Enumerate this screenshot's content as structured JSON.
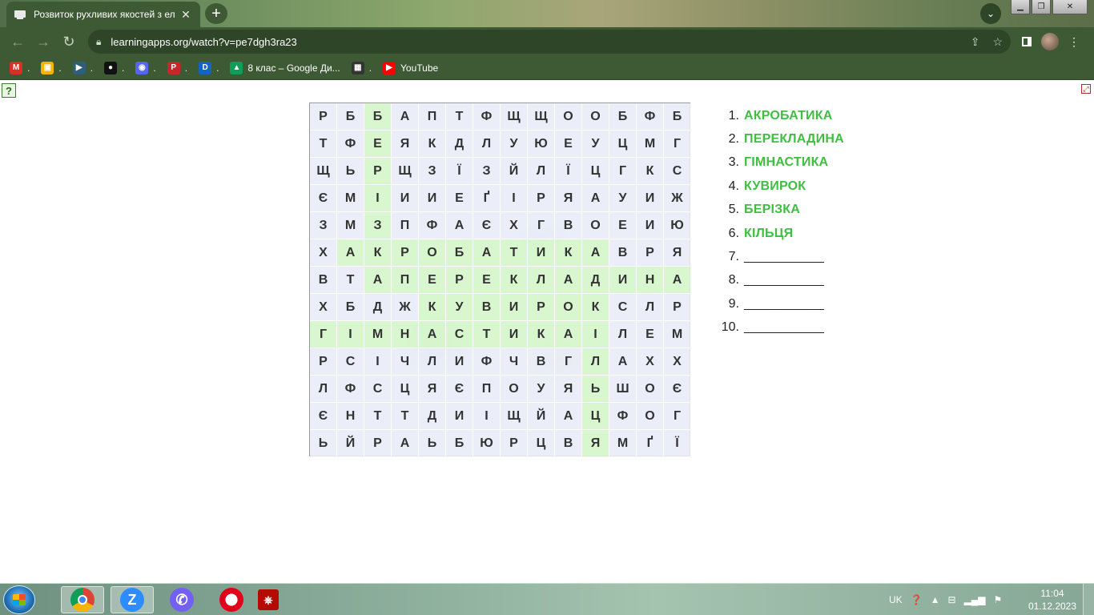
{
  "browser": {
    "tab_title": "Розвиток рухливих якостей з ел",
    "tab_close": "✕",
    "new_tab": "+",
    "url": "learningapps.org/watch?v=pe7dgh3ra23",
    "bookmarks": [
      {
        "name": "gmail",
        "label": ".",
        "color": "#d93025",
        "glyph": "M"
      },
      {
        "name": "drive-slides",
        "label": ".",
        "color": "#f4b400",
        "glyph": "▣"
      },
      {
        "name": "play",
        "label": ".",
        "color": "#2d5f7a",
        "glyph": "▶"
      },
      {
        "name": "ghost",
        "label": ".",
        "color": "#111111",
        "glyph": "●"
      },
      {
        "name": "discord",
        "label": ".",
        "color": "#5865f2",
        "glyph": "◉"
      },
      {
        "name": "p-app",
        "label": ".",
        "color": "#c62828",
        "glyph": "P"
      },
      {
        "name": "d-app",
        "label": ".",
        "color": "#1565c0",
        "glyph": "D"
      },
      {
        "name": "google-drive",
        "label": "8 клас – Google Ди...",
        "color": "#0f9d58",
        "glyph": "▲"
      },
      {
        "name": "pattern",
        "label": ".",
        "color": "#333333",
        "glyph": "▦"
      },
      {
        "name": "youtube",
        "label": "YouTube",
        "color": "#ff0000",
        "glyph": "▶"
      }
    ]
  },
  "page": {
    "help_glyph": "?",
    "fullscreen_glyph": "⤢"
  },
  "puzzle": {
    "rows": [
      "РББАПТФЩЩООБФБ",
      "ТФЕЯКДЛУЮЕУЦМГ",
      "ЩЬРЩЗЇЗЙЛЇЦГКС",
      "ЄМІИИЕҐІРЯАУИЖ",
      "ЗМЗПФАЄХГВОЕИЮ",
      "ХАКРОБАТИКАВРЯ",
      "ВТАПЕРЕКЛАДИНА",
      "ХБДЖКУВИРОКСЛР",
      "ГІМНАСТИКАІЛЕМ",
      "РСІЧЛИФЧВГЛАХХ",
      "ЛФСЦЯЄПОУЯЬШОЄ",
      "ЄНТТДИІЩЙАЦФОГ",
      "ЬЙРАЬБЮРЦВЯМҐЇ"
    ],
    "highlighted": [
      "0-2",
      "1-2",
      "2-2",
      "3-2",
      "4-2",
      "5-1",
      "5-2",
      "5-3",
      "5-4",
      "5-5",
      "5-6",
      "5-7",
      "5-8",
      "5-9",
      "5-10",
      "6-2",
      "6-3",
      "6-4",
      "6-5",
      "6-6",
      "6-7",
      "6-8",
      "6-9",
      "6-10",
      "6-11",
      "6-12",
      "6-13",
      "7-4",
      "7-5",
      "7-6",
      "7-7",
      "7-8",
      "7-9",
      "7-10",
      "8-0",
      "8-1",
      "8-2",
      "8-3",
      "8-4",
      "8-5",
      "8-6",
      "8-7",
      "8-8",
      "8-9",
      "8-10",
      "8-10",
      "9-10",
      "10-10",
      "11-10",
      "12-10"
    ],
    "words": [
      {
        "num": "1.",
        "text": "АКРОБАТИКА",
        "found": true
      },
      {
        "num": "2.",
        "text": "ПЕРЕКЛАДИНА",
        "found": true
      },
      {
        "num": "3.",
        "text": "ГІМНАСТИКА",
        "found": true
      },
      {
        "num": "4.",
        "text": "КУВИРОК",
        "found": true
      },
      {
        "num": "5.",
        "text": "БЕРІЗКА",
        "found": true
      },
      {
        "num": "6.",
        "text": "КІЛЬЦЯ",
        "found": true
      },
      {
        "num": "7.",
        "text": "___________",
        "found": false
      },
      {
        "num": "8.",
        "text": "___________",
        "found": false
      },
      {
        "num": "9.",
        "text": "___________",
        "found": false
      },
      {
        "num": "10.",
        "text": "___________",
        "found": false
      }
    ]
  },
  "taskbar": {
    "language": "UK",
    "time": "11:04",
    "date": "01.12.2023"
  }
}
